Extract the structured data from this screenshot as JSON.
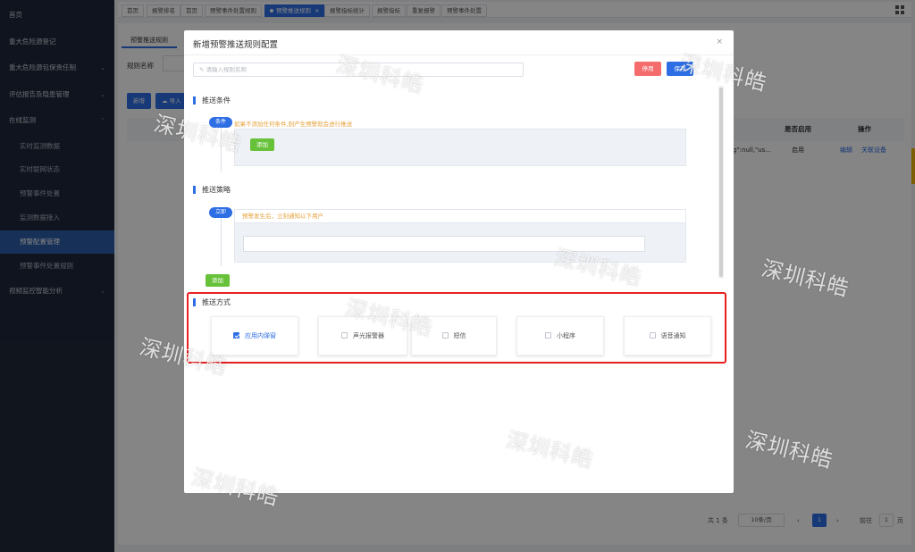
{
  "sidebar": {
    "items": [
      {
        "label": "首页"
      },
      {
        "label": "重大危险源登记"
      },
      {
        "label": "重大危险源包保责任制"
      },
      {
        "label": "评估报告及隐患管理"
      },
      {
        "label": "在线监测"
      },
      {
        "label": "实时监测数据"
      },
      {
        "label": "实时联网状态"
      },
      {
        "label": "预警事件处置"
      },
      {
        "label": "监测数据接入"
      },
      {
        "label": "预警配置管理"
      },
      {
        "label": "预警事件处置规则"
      },
      {
        "label": "视频监控智能分析"
      }
    ]
  },
  "tabs": [
    {
      "label": "首页"
    },
    {
      "label": "报警排名"
    },
    {
      "label": "首页"
    },
    {
      "label": "预警事件处置规则"
    },
    {
      "label": "预警推送规则"
    },
    {
      "label": "报警指标统计"
    },
    {
      "label": "报警指标"
    },
    {
      "label": "重复报警"
    },
    {
      "label": "预警事件处置"
    }
  ],
  "page": {
    "tab_label": "预警推送规则",
    "rule_name_label": "规则名称",
    "new_button": "新增",
    "import_button": "导入",
    "headers": {
      "enabled": "是否启用",
      "actions": "操作"
    },
    "row": {
      "snippet": "g\":null,\"us...",
      "enabled": "启用",
      "edit": "编辑",
      "related": "关联设备"
    },
    "pagination": {
      "total": "共 1 条",
      "page_size": "10条/页",
      "current_page": "1",
      "goto_label": "前往",
      "goto_value": "1",
      "page_unit": "页"
    }
  },
  "modal": {
    "title": "新增预警推送规则配置",
    "close_glyph": "×",
    "rule_name_placeholder": "请输入规则名称",
    "disable_button": "停用",
    "save_button": "保存",
    "condition": {
      "title": "推送条件",
      "node_label": "条件",
      "hint": "如果不添加任何条件,则产生预警就会进行推送",
      "add_button": "添加"
    },
    "strategy": {
      "title": "推送策略",
      "node_label": "立即",
      "hint": "预警发生后，立刻通知以下用户",
      "add_button": "添加"
    },
    "method": {
      "title": "推送方式",
      "options": [
        {
          "label": "应用内弹窗",
          "checked": true
        },
        {
          "label": "声光报警器",
          "checked": false
        },
        {
          "label": "短信",
          "checked": false
        },
        {
          "label": "小程序",
          "checked": false
        },
        {
          "label": "语音通知",
          "checked": false
        }
      ]
    }
  },
  "watermark": "深圳科皓",
  "colors": {
    "sidebar_bg": "#20283a",
    "primary": "#2d6ee4",
    "danger": "#f56c6c",
    "success": "#67c23a",
    "warning_text": "#e6a23c",
    "highlight": "#e82020"
  }
}
